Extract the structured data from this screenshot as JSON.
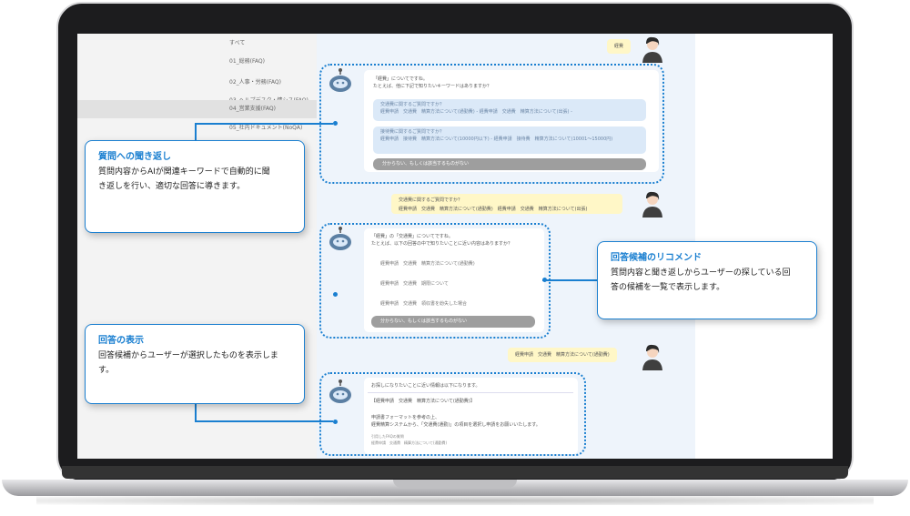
{
  "sidebar": {
    "items": [
      {
        "label": "すべて"
      },
      {
        "label": "01_総務(FAQ)"
      },
      {
        "label": "02_人事・労務(FAQ)"
      },
      {
        "label": "03_ヘルプデスク・情シス(FAQ)"
      },
      {
        "label": "04_営業支援(FAQ)"
      },
      {
        "label": "05_社内ドキュメント(NoQA)"
      }
    ]
  },
  "chat": {
    "user_msg_1": "経費",
    "bot_1": {
      "line1": "「経費」についてですね。",
      "line2": "たとえば、他に下記で知りたいキーワードはありますか？",
      "option1_title": "交通費に関するご質問ですか？",
      "option1_body": "経費申請　交通費　精算方法について(通勤費) ‐ 経費申請　交通費　精算方法について(出張) ‐",
      "option2_title": "接待費に関するご質問ですか？",
      "option2_body": "経費申請　接待費　精算方法について(10000円以下) ‐ 経費申請　接待費　精算方法について(10001～15000円)",
      "none": "分からない、もしくは該当するものがない"
    },
    "user_msg_2_title": "交通費に関するご質問ですか？",
    "user_msg_2_body": "経費申請　交通費　精算方法について(通勤費)　経費申請　交通費　精算方法について(出張)",
    "bot_2": {
      "line1": "「経費」の「交通費」についてですね。",
      "line2": "たとえば、以下の回答の中で知りたいことに近い内容はありますか？",
      "item1": "経費申請　交通費　精算方法について(通勤費)",
      "item2": "経費申請　交通費　期限について",
      "item3": "経費申請　交通費　領収書を紛失した場合",
      "none": "分からない、もしくは該当するものがない"
    },
    "user_msg_3": "経費申請　交通費　精算方法について(通勤費)",
    "bot_3": {
      "line1": "お探しになりたいことに近い情報は以下になります。",
      "title": "【経費申請　交通費　精算方法について(通勤費)】",
      "line3": "申請書フォーマットを参考の上、",
      "line4": "経費精算システムから、「交通費(通勤)」の項目を選択し申請をお願いいたします。",
      "note1": "引用したFAQの質問",
      "note2": "経費申請　交通費　精算方法について(通勤費)"
    }
  },
  "callouts": {
    "c1_title": "質問への聞き返し",
    "c1_desc1": "質問内容からAIが関連キーワードで自動的に聞",
    "c1_desc2": "き返しを行い、適切な回答に導きます。",
    "c2_title": "回答候補のリコメンド",
    "c2_desc1": "質問内容と聞き返しからユーザーの探している回",
    "c2_desc2": "答の候補を一覧で表示します。",
    "c3_title": "回答の表示",
    "c3_desc1": "回答候補からユーザーが選択したものを表示しま",
    "c3_desc2": "す。"
  },
  "colors": {
    "accent": "#1a7fd0",
    "user_bubble": "#fff7c7",
    "chat_bg": "#eef4fb",
    "option_bg": "#dbe9f8"
  },
  "icons": {
    "bot": "robot-icon",
    "user": "user-avatar-icon"
  }
}
